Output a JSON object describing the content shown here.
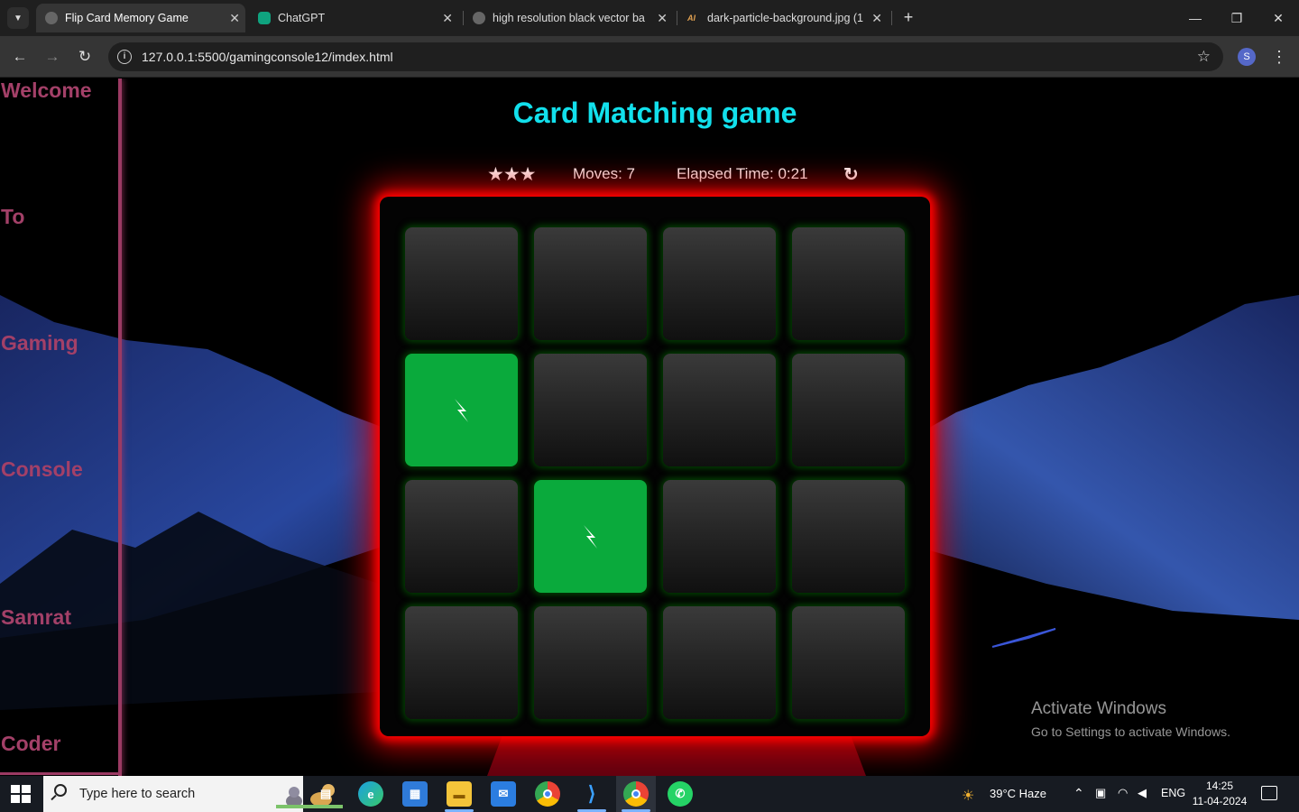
{
  "browser": {
    "tabs": [
      {
        "title": "Flip Card Memory Game",
        "active": true
      },
      {
        "title": "ChatGPT",
        "active": false
      },
      {
        "title": "high resolution black vector ba",
        "active": false
      },
      {
        "title": "dark-particle-background.jpg (1",
        "active": false
      }
    ],
    "url": "127.0.0.1:5500/gamingconsole12/imdex.html",
    "profile_initial": "S"
  },
  "sidebar": {
    "words": [
      "Welcome",
      "To",
      "Gaming",
      "Console",
      "Samrat",
      "Coder"
    ]
  },
  "game": {
    "title": "Card Matching game",
    "stars": "★★★",
    "moves_label": "Moves: ",
    "moves": "7",
    "time_label": "Elapsed Time: ",
    "time": "0:21",
    "restart_icon": "↻",
    "cards": [
      {
        "state": "closed",
        "symbol": ""
      },
      {
        "state": "closed",
        "symbol": ""
      },
      {
        "state": "closed",
        "symbol": ""
      },
      {
        "state": "closed",
        "symbol": ""
      },
      {
        "state": "open",
        "symbol": "bolt"
      },
      {
        "state": "closed",
        "symbol": ""
      },
      {
        "state": "closed",
        "symbol": ""
      },
      {
        "state": "closed",
        "symbol": ""
      },
      {
        "state": "closed",
        "symbol": ""
      },
      {
        "state": "open",
        "symbol": "bolt"
      },
      {
        "state": "closed",
        "symbol": ""
      },
      {
        "state": "closed",
        "symbol": ""
      },
      {
        "state": "closed",
        "symbol": ""
      },
      {
        "state": "closed",
        "symbol": ""
      },
      {
        "state": "closed",
        "symbol": ""
      },
      {
        "state": "closed",
        "symbol": ""
      }
    ]
  },
  "watermark": {
    "line1": "Activate Windows",
    "line2": "Go to Settings to activate Windows."
  },
  "taskbar": {
    "search_placeholder": "Type here to search",
    "weather": "39°C  Haze",
    "language": "ENG",
    "time": "14:25",
    "date": "11-04-2024"
  },
  "colors": {
    "title": "#12e0ec",
    "sidebar_text": "#a34068",
    "deck_glow": "#ff0000",
    "open_card": "#0aaa3c"
  }
}
